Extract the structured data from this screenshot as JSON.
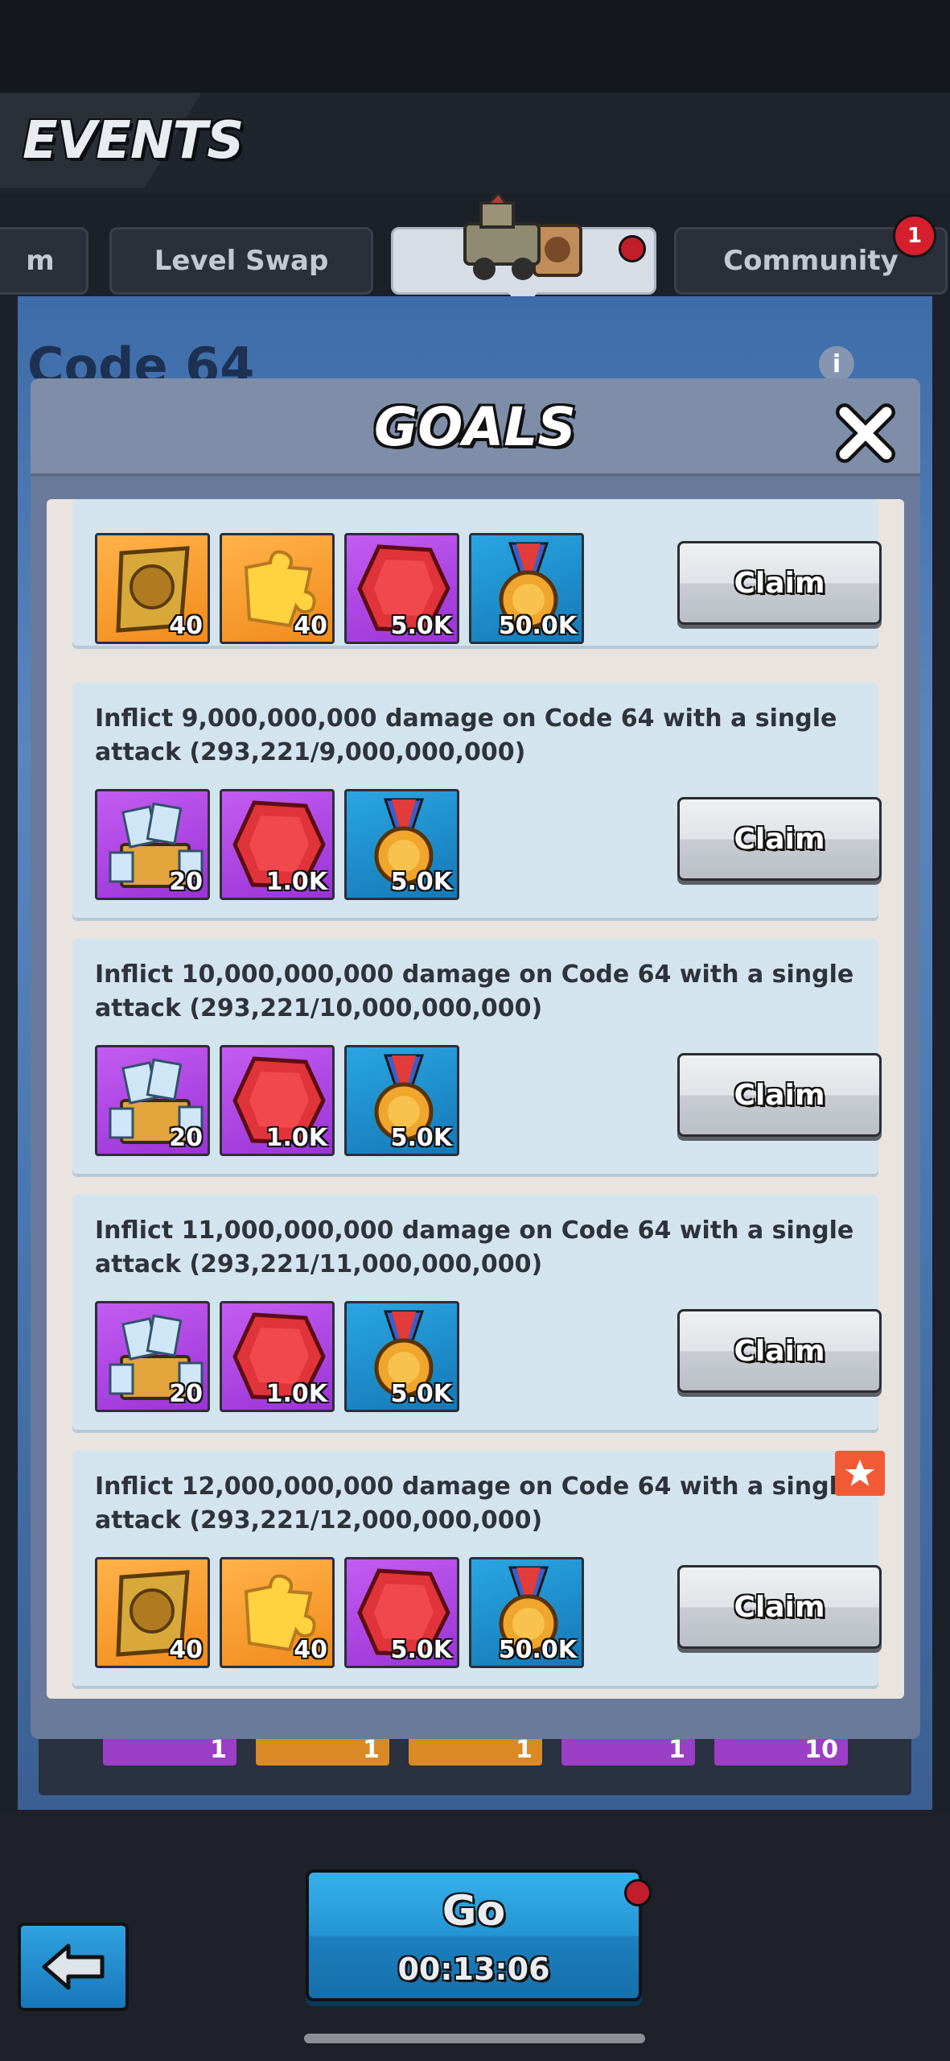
{
  "header": {
    "title": "EVENTS"
  },
  "tabs": [
    {
      "label": "m"
    },
    {
      "label": "Level Swap"
    },
    {
      "label": ""
    },
    {
      "label": "Community",
      "badge": "1"
    }
  ],
  "background": {
    "event_title": "Code 64",
    "info": "i",
    "chips": [
      "1",
      "1",
      "1",
      "1",
      "10"
    ]
  },
  "modal": {
    "title": "GOALS",
    "goals": [
      {
        "text": "",
        "rewards": [
          {
            "type": "gold-badge-icon",
            "count": "40"
          },
          {
            "type": "gold-puzzle-icon",
            "count": "40"
          },
          {
            "type": "red-gem-icon",
            "count": "5.0K"
          },
          {
            "type": "medal-icon",
            "count": "50.0K"
          }
        ],
        "claim_label": "Claim"
      },
      {
        "text": "Inflict 9,000,000,000 damage on Code 64 with a single attack (293,221/9,000,000,000)",
        "rewards": [
          {
            "type": "xp-chest-icon",
            "count": "20"
          },
          {
            "type": "red-gem-icon",
            "count": "1.0K"
          },
          {
            "type": "medal-icon",
            "count": "5.0K"
          }
        ],
        "claim_label": "Claim"
      },
      {
        "text": "Inflict 10,000,000,000 damage on Code 64 with a single attack (293,221/10,000,000,000)",
        "rewards": [
          {
            "type": "xp-chest-icon",
            "count": "20"
          },
          {
            "type": "red-gem-icon",
            "count": "1.0K"
          },
          {
            "type": "medal-icon",
            "count": "5.0K"
          }
        ],
        "claim_label": "Claim"
      },
      {
        "text": "Inflict 11,000,000,000 damage on Code 64 with a single attack (293,221/11,000,000,000)",
        "rewards": [
          {
            "type": "xp-chest-icon",
            "count": "20"
          },
          {
            "type": "red-gem-icon",
            "count": "1.0K"
          },
          {
            "type": "medal-icon",
            "count": "5.0K"
          }
        ],
        "claim_label": "Claim"
      },
      {
        "text": "Inflict 12,000,000,000 damage on Code 64 with a single attack (293,221/12,000,000,000)",
        "rewards": [
          {
            "type": "gold-badge-icon",
            "count": "40"
          },
          {
            "type": "gold-puzzle-icon",
            "count": "40"
          },
          {
            "type": "red-gem-icon",
            "count": "5.0K"
          },
          {
            "type": "medal-icon",
            "count": "50.0K"
          }
        ],
        "claim_label": "Claim"
      }
    ]
  },
  "footer": {
    "go_label": "Go",
    "timer": "00:13:06"
  },
  "colors": {
    "accent_blue": "#2495d4",
    "gem_red": "#e0343a",
    "reward_orange": "#f18a1b",
    "reward_purple": "#9a33d6",
    "panel": "#d4e4ee"
  }
}
